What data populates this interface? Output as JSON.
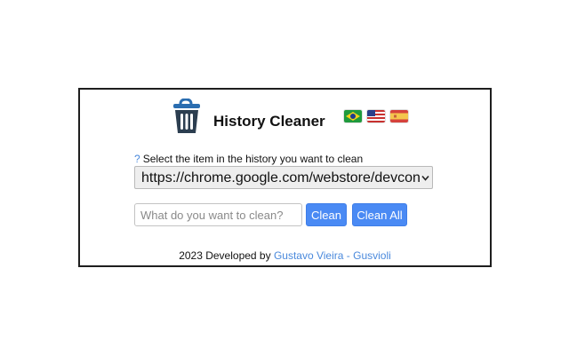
{
  "header": {
    "title": "History Cleaner",
    "logo_icon": "trash-can-icon",
    "languages": [
      {
        "code": "pt-BR",
        "icon": "brazil-flag-icon"
      },
      {
        "code": "en-US",
        "icon": "usa-flag-icon"
      },
      {
        "code": "es",
        "icon": "spain-flag-icon"
      }
    ]
  },
  "form": {
    "help_icon_text": "?",
    "select_label": "Select the item in the history you want to clean",
    "selected_history_item": "https://chrome.google.com/webstore/devconsole",
    "input_placeholder": "What do you want to clean?",
    "clean_label": "Clean",
    "clean_all_label": "Clean All"
  },
  "footer": {
    "prefix": "2023 Developed by",
    "author_link": "Gustavo Vieira - Gusvioli"
  },
  "colors": {
    "accent": "#4a8af4",
    "link": "#4a89dc",
    "logo": "#2c3e50"
  }
}
